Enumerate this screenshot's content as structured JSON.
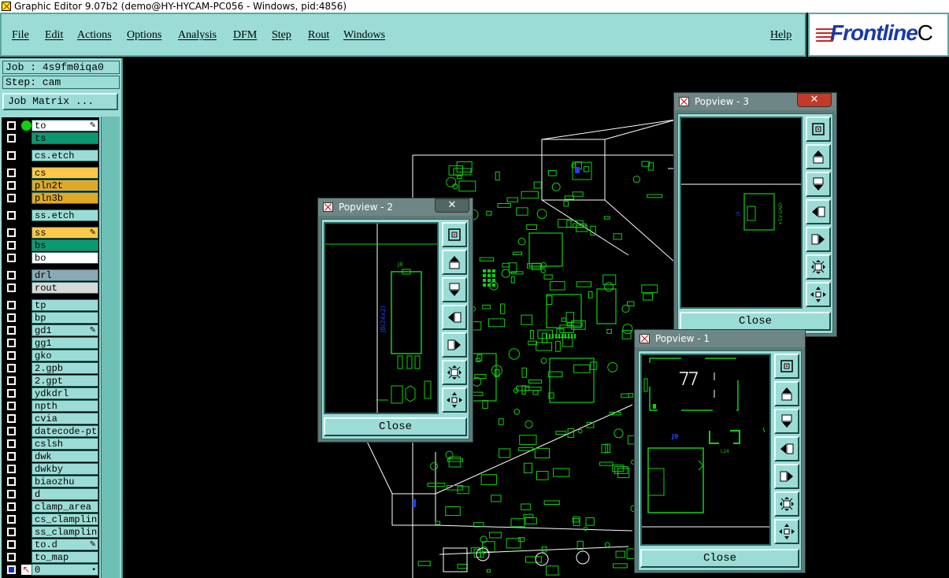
{
  "window": {
    "title": "Graphic Editor 9.07b2 (demo@HY-HYCAM-PC056 - Windows, pid:4856)"
  },
  "menu": {
    "items": [
      "File",
      "Edit",
      "Actions",
      "Options",
      "Analysis",
      "DFM",
      "Step",
      "Rout",
      "Windows"
    ],
    "help": "Help"
  },
  "logo": {
    "text": "Frontline",
    "tail": "C"
  },
  "job": {
    "label": "Job : 4s9fm0iqa0",
    "step": "Step: cam",
    "matrix_button": "Job Matrix ..."
  },
  "colors": {
    "panel": "#9cdcd6",
    "board": "#10d010",
    "outline": "#ffffff",
    "layer_yellow": "#ffc848",
    "layer_orange": "#e0a828",
    "layer_green": "#0a9870",
    "layer_white": "#ffffff",
    "layer_gray": "#8ca8b4",
    "layer_lightgray": "#d8d8d8"
  },
  "layers": [
    {
      "name": "to",
      "color": "#ffffff",
      "active": true,
      "mark": "pencil"
    },
    {
      "name": "ts",
      "color": "#0a9870"
    },
    {
      "name": "cs.etch",
      "color": "#9cdcd6"
    },
    {
      "name": "cs",
      "color": "#ffc848"
    },
    {
      "name": "pln2t",
      "color": "#e0a828"
    },
    {
      "name": "pln3b",
      "color": "#e0a828"
    },
    {
      "name": "ss.etch",
      "color": "#9cdcd6"
    },
    {
      "name": "ss",
      "color": "#ffc848",
      "mark": "pencil"
    },
    {
      "name": "bs",
      "color": "#0a9870"
    },
    {
      "name": "bo",
      "color": "#ffffff"
    },
    {
      "name": "drl",
      "color": "#8ca8b4"
    },
    {
      "name": "rout",
      "color": "#d8d8d8"
    },
    {
      "name": "tp",
      "color": "#9cdcd6"
    },
    {
      "name": "bp",
      "color": "#9cdcd6"
    },
    {
      "name": "gd1",
      "color": "#9cdcd6",
      "mark": "pencil"
    },
    {
      "name": "gg1",
      "color": "#9cdcd6"
    },
    {
      "name": "gko",
      "color": "#9cdcd6"
    },
    {
      "name": "2.gpb",
      "color": "#9cdcd6"
    },
    {
      "name": "2.gpt",
      "color": "#9cdcd6"
    },
    {
      "name": "ydkdrl",
      "color": "#9cdcd6"
    },
    {
      "name": "npth",
      "color": "#9cdcd6"
    },
    {
      "name": "cvia",
      "color": "#9cdcd6"
    },
    {
      "name": "datecode-ptc",
      "color": "#9cdcd6"
    },
    {
      "name": "cslsh",
      "color": "#9cdcd6"
    },
    {
      "name": "dwk",
      "color": "#9cdcd6"
    },
    {
      "name": "dwkby",
      "color": "#9cdcd6"
    },
    {
      "name": "biaozhu",
      "color": "#9cdcd6"
    },
    {
      "name": "d",
      "color": "#9cdcd6"
    },
    {
      "name": "clamp_area",
      "color": "#9cdcd6"
    },
    {
      "name": "cs_clampline",
      "color": "#9cdcd6"
    },
    {
      "name": "ss_clampline",
      "color": "#9cdcd6"
    },
    {
      "name": "to.d",
      "color": "#9cdcd6",
      "mark": "pencil"
    },
    {
      "name": "to_map",
      "color": "#9cdcd6"
    },
    {
      "name": "0",
      "color": "#9cdcd6",
      "mark": "box"
    }
  ],
  "popups": [
    {
      "title": "Popview - 2",
      "close_label": "Close",
      "close_x": "✕",
      "labels": [
        "J8",
        "J8(24x2)"
      ]
    },
    {
      "title": "Popview - 3",
      "close_label": "Close",
      "close_x": "✕",
      "labels": [
        "J9",
        "+5V GND"
      ]
    },
    {
      "title": "Popview - 1",
      "close_label": "Close",
      "labels": [
        "J9",
        "L24"
      ]
    }
  ],
  "tool_icons": [
    "zoom-fit-icon",
    "pan-up-icon",
    "pan-down-icon",
    "pan-left-icon",
    "pan-right-icon",
    "zoom-out-icon",
    "zoom-in-icon"
  ]
}
